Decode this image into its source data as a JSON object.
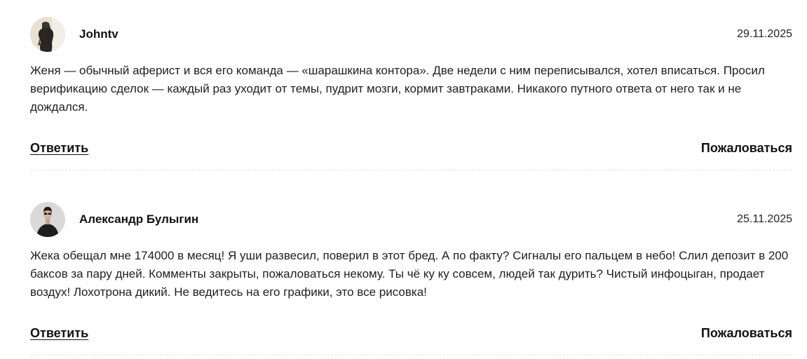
{
  "comments": [
    {
      "author": "Johntv",
      "date": "29.11.2025",
      "text": "Женя — обычный аферист и вся его команда — «шарашкина контора». Две недели с ним переписывался, хотел вписаться. Просил верификацию сделок — каждый раз уходит от темы, пудрит мозги, кормит завтраками. Никакого путного ответа от него так и не дождался.",
      "reply_label": "Ответить",
      "report_label": "Пожаловаться"
    },
    {
      "author": "Александр Булыгин",
      "date": "25.11.2025",
      "text": "Жека обещал мне 174000 в месяц! Я уши развесил, поверил в этот бред. А по факту? Сигналы его пальцем в небо! Слил депозит в 200 баксов за пару дней. Комменты закрыты, пожаловаться некому. Ты чё ку ку совсем, людей так дурить? Чистый инфоцыган, продает воздух! Лохотрона дикий. Не ведитесь на его графики, это все рисовка!",
      "reply_label": "Ответить",
      "report_label": "Пожаловаться"
    }
  ]
}
